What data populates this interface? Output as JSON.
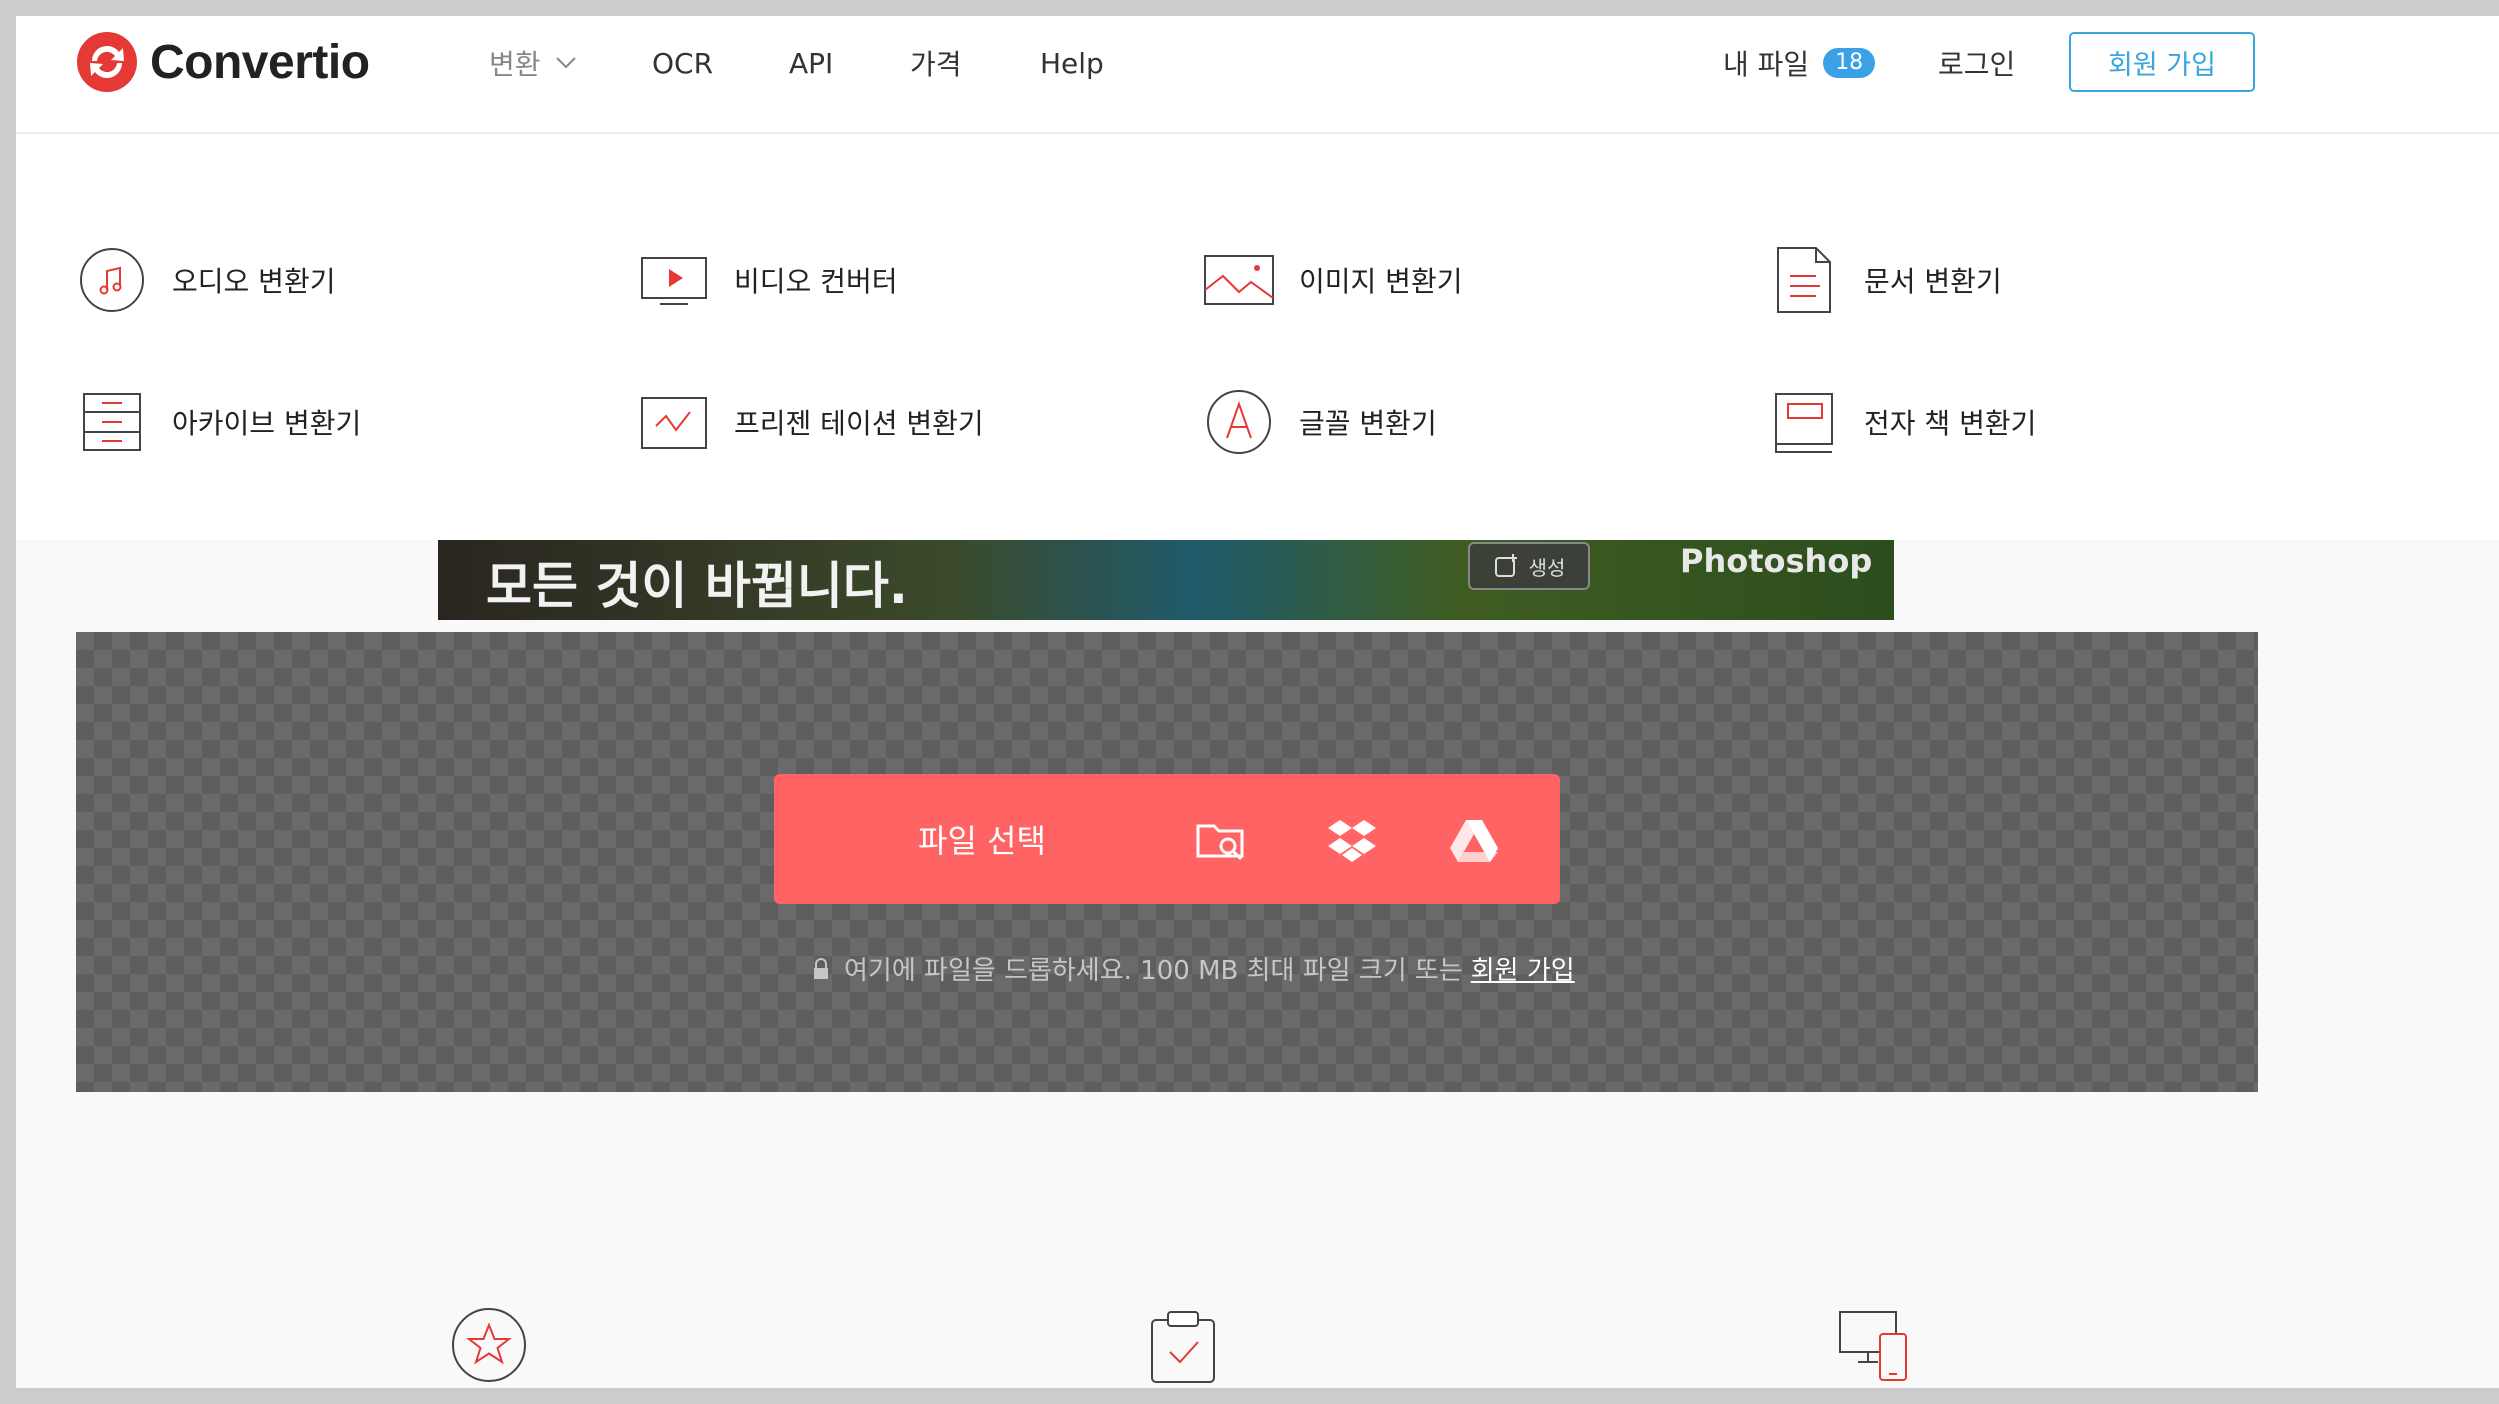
{
  "header": {
    "logo_text": "Convertio",
    "nav": {
      "convert": "변환",
      "ocr": "OCR",
      "api": "API",
      "price": "가격",
      "help": "Help"
    },
    "my_files": "내 파일",
    "my_files_count": "18",
    "login": "로그인",
    "signup": "회원 가입"
  },
  "dropdown": {
    "categories": [
      {
        "label": "오디오 변환기",
        "icon": "music-note-icon"
      },
      {
        "label": "비디오 컨버터",
        "icon": "video-play-icon"
      },
      {
        "label": "이미지 변환기",
        "icon": "image-icon"
      },
      {
        "label": "문서 변환기",
        "icon": "document-icon"
      },
      {
        "label": "아카이브 변환기",
        "icon": "archive-icon"
      },
      {
        "label": "프리젠 테이션 변환기",
        "icon": "presentation-icon"
      },
      {
        "label": "글꼴 변환기",
        "icon": "font-icon"
      },
      {
        "label": "전자 책 변환기",
        "icon": "ebook-icon"
      }
    ]
  },
  "banner": {
    "headline": "모든 것이 바뀝니다.",
    "generate": "생성",
    "brand": "Photoshop"
  },
  "upload": {
    "choose_files": "파일 선택",
    "drop_hint": "여기에 파일을 드롭하세요. 100 MB 최대 파일 크기 또는",
    "drop_signup": "회원 가입"
  },
  "colors": {
    "brand_red": "#e53935",
    "choose_button": "#ff6363",
    "accent_blue": "#3aa1e6"
  }
}
